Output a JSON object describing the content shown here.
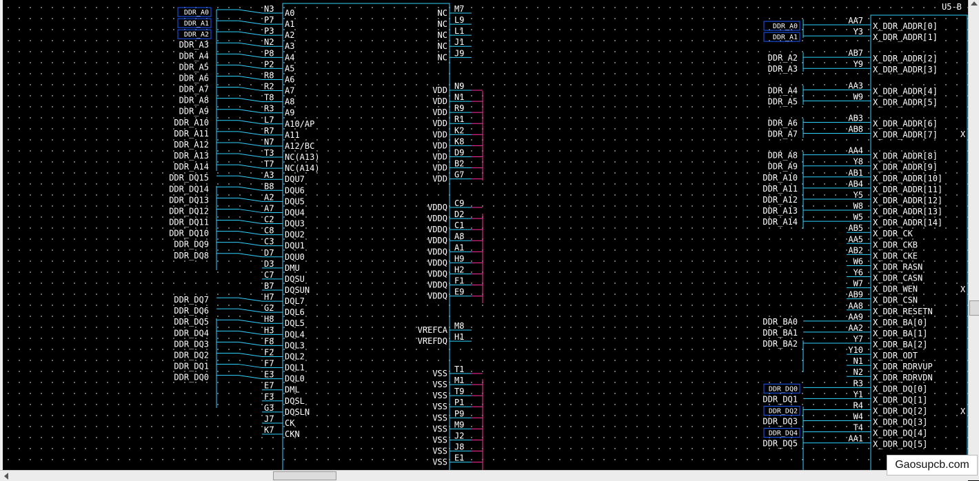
{
  "sheet_ref": "U5-B",
  "watermark": "Gaosupcb.com",
  "colors": {
    "background": "#000000",
    "wire": "#2fd2ff",
    "power_wire": "#ff2fa0",
    "text": "#ffffff",
    "net_box": "#1d5aff"
  },
  "memory_chip": {
    "left_pins": [
      {
        "net": "DDR_A0",
        "pin": "N3",
        "name": "A0"
      },
      {
        "net": "DDR_A1",
        "pin": "P7",
        "name": "A1"
      },
      {
        "net": "DDR_A2",
        "pin": "P3",
        "name": "A2"
      },
      {
        "net": "DDR_A3",
        "pin": "N2",
        "name": "A3"
      },
      {
        "net": "DDR_A4",
        "pin": "P8",
        "name": "A4"
      },
      {
        "net": "DDR_A5",
        "pin": "P2",
        "name": "A5"
      },
      {
        "net": "DDR_A6",
        "pin": "R8",
        "name": "A6"
      },
      {
        "net": "DDR_A7",
        "pin": "R2",
        "name": "A7"
      },
      {
        "net": "DDR_A8",
        "pin": "T8",
        "name": "A8"
      },
      {
        "net": "DDR_A9",
        "pin": "R3",
        "name": "A9"
      },
      {
        "net": "DDR_A10",
        "pin": "L7",
        "name": "A10/AP"
      },
      {
        "net": "DDR_A11",
        "pin": "R7",
        "name": "A11"
      },
      {
        "net": "DDR_A12",
        "pin": "N7",
        "name": "A12/BC"
      },
      {
        "net": "DDR_A13",
        "pin": "T3",
        "name": "NC(A13)"
      },
      {
        "net": "DDR_A14",
        "pin": "T7",
        "name": "NC(A14)"
      },
      {
        "net": "DDR_DQ15",
        "pin": "A3",
        "name": "DQU7"
      },
      {
        "net": "DDR_DQ14",
        "pin": "B8",
        "name": "DQU6"
      },
      {
        "net": "DDR_DQ13",
        "pin": "A2",
        "name": "DQU5"
      },
      {
        "net": "DDR_DQ12",
        "pin": "A7",
        "name": "DQU4"
      },
      {
        "net": "DDR_DQ11",
        "pin": "C2",
        "name": "DQU3"
      },
      {
        "net": "DDR_DQ10",
        "pin": "C8",
        "name": "DQU2"
      },
      {
        "net": "DDR_DQ9",
        "pin": "C3",
        "name": "DQU1"
      },
      {
        "net": "DDR_DQ8",
        "pin": "D7",
        "name": "DQU0"
      },
      {
        "net": "",
        "pin": "D3",
        "name": "DMU"
      },
      {
        "net": "",
        "pin": "C7",
        "name": "DQSU"
      },
      {
        "net": "",
        "pin": "B7",
        "name": "DQSUN"
      },
      {
        "net": "DDR_DQ7",
        "pin": "H7",
        "name": "DQL7"
      },
      {
        "net": "DDR_DQ6",
        "pin": "G2",
        "name": "DQL6"
      },
      {
        "net": "DDR_DQ5",
        "pin": "H8",
        "name": "DQL5"
      },
      {
        "net": "DDR_DQ4",
        "pin": "H3",
        "name": "DQL4"
      },
      {
        "net": "DDR_DQ3",
        "pin": "F8",
        "name": "DQL3"
      },
      {
        "net": "DDR_DQ2",
        "pin": "F2",
        "name": "DQL2"
      },
      {
        "net": "DDR_DQ1",
        "pin": "F7",
        "name": "DQL1"
      },
      {
        "net": "DDR_DQ0",
        "pin": "E3",
        "name": "DQL0"
      },
      {
        "net": "",
        "pin": "E7",
        "name": "DML"
      },
      {
        "net": "",
        "pin": "F3",
        "name": "DQSL"
      },
      {
        "net": "",
        "pin": "G3",
        "name": "DQSLN"
      },
      {
        "net": "",
        "pin": "J7",
        "name": "CK"
      },
      {
        "net": "",
        "pin": "K7",
        "name": "CKN"
      }
    ],
    "right_pins": [
      {
        "name": "NC",
        "pin": "M7"
      },
      {
        "name": "NC",
        "pin": "L9"
      },
      {
        "name": "NC",
        "pin": "L1"
      },
      {
        "name": "NC",
        "pin": "J1"
      },
      {
        "name": "NC",
        "pin": "J9"
      },
      {
        "name": "VDD",
        "pin": "N9"
      },
      {
        "name": "VDD",
        "pin": "N1"
      },
      {
        "name": "VDD",
        "pin": "R9"
      },
      {
        "name": "VDD",
        "pin": "R1"
      },
      {
        "name": "VDD",
        "pin": "K2"
      },
      {
        "name": "VDD",
        "pin": "K8"
      },
      {
        "name": "VDD",
        "pin": "D9"
      },
      {
        "name": "VDD",
        "pin": "B2"
      },
      {
        "name": "VDD",
        "pin": "G7"
      },
      {
        "name": "VDDQ",
        "pin": "C9"
      },
      {
        "name": "VDDQ",
        "pin": "D2"
      },
      {
        "name": "VDDQ",
        "pin": "C1"
      },
      {
        "name": "VDDQ",
        "pin": "A8"
      },
      {
        "name": "VDDQ",
        "pin": "A1"
      },
      {
        "name": "VDDQ",
        "pin": "H9"
      },
      {
        "name": "VDDQ",
        "pin": "H2"
      },
      {
        "name": "VDDQ",
        "pin": "F1"
      },
      {
        "name": "VDDQ",
        "pin": "E9"
      },
      {
        "name": "VREFCA",
        "pin": "M8"
      },
      {
        "name": "VREFDQ",
        "pin": "H1"
      },
      {
        "name": "VSS",
        "pin": "T1"
      },
      {
        "name": "VSS",
        "pin": "M1"
      },
      {
        "name": "VSS",
        "pin": "T9"
      },
      {
        "name": "VSS",
        "pin": "P1"
      },
      {
        "name": "VSS",
        "pin": "P9"
      },
      {
        "name": "VSS",
        "pin": "M9"
      },
      {
        "name": "VSS",
        "pin": "J2"
      },
      {
        "name": "VSS",
        "pin": "J8"
      },
      {
        "name": "VSS",
        "pin": "E1"
      }
    ]
  },
  "controller": {
    "pins": [
      {
        "net": "DDR_A0",
        "pin": "AA7",
        "name": "X_DDR_ADDR[0]"
      },
      {
        "net": "DDR_A1",
        "pin": "Y3",
        "name": "X_DDR_ADDR[1]"
      },
      {
        "net": "DDR_A2",
        "pin": "AB7",
        "name": "X_DDR_ADDR[2]"
      },
      {
        "net": "DDR_A3",
        "pin": "Y9",
        "name": "X_DDR_ADDR[3]"
      },
      {
        "net": "DDR_A4",
        "pin": "AA3",
        "name": "X_DDR_ADDR[4]"
      },
      {
        "net": "DDR_A5",
        "pin": "W9",
        "name": "X_DDR_ADDR[5]"
      },
      {
        "net": "DDR_A6",
        "pin": "AB3",
        "name": "X_DDR_ADDR[6]"
      },
      {
        "net": "DDR_A7",
        "pin": "AB8",
        "name": "X_DDR_ADDR[7]"
      },
      {
        "net": "DDR_A8",
        "pin": "AA4",
        "name": "X_DDR_ADDR[8]"
      },
      {
        "net": "DDR_A9",
        "pin": "Y8",
        "name": "X_DDR_ADDR[9]"
      },
      {
        "net": "DDR_A10",
        "pin": "AB1",
        "name": "X_DDR_ADDR[10]"
      },
      {
        "net": "DDR_A11",
        "pin": "AB4",
        "name": "X_DDR_ADDR[11]"
      },
      {
        "net": "DDR_A12",
        "pin": "Y5",
        "name": "X_DDR_ADDR[12]"
      },
      {
        "net": "DDR_A13",
        "pin": "W8",
        "name": "X_DDR_ADDR[13]"
      },
      {
        "net": "DDR_A14",
        "pin": "W5",
        "name": "X_DDR_ADDR[14]"
      },
      {
        "net": "",
        "pin": "AB5",
        "name": "X_DDR_CK"
      },
      {
        "net": "",
        "pin": "AA5",
        "name": "X_DDR_CKB"
      },
      {
        "net": "",
        "pin": "AB2",
        "name": "X_DDR_CKE"
      },
      {
        "net": "",
        "pin": "W6",
        "name": "X_DDR_RASN"
      },
      {
        "net": "",
        "pin": "Y6",
        "name": "X_DDR_CASN"
      },
      {
        "net": "",
        "pin": "W7",
        "name": "X_DDR_WEN"
      },
      {
        "net": "",
        "pin": "AB9",
        "name": "X_DDR_CSN"
      },
      {
        "net": "",
        "pin": "AA8",
        "name": "X_DDR_RESETN"
      },
      {
        "net": "DDR_BA0",
        "pin": "AA9",
        "name": "X_DDR_BA[0]"
      },
      {
        "net": "DDR_BA1",
        "pin": "AA2",
        "name": "X_DDR_BA[1]"
      },
      {
        "net": "DDR_BA2",
        "pin": "Y7",
        "name": "X_DDR_BA[2]"
      },
      {
        "net": "",
        "pin": "Y10",
        "name": "X_DDR_ODT"
      },
      {
        "net": "",
        "pin": "N1",
        "name": "X_DDR_RDRVUP"
      },
      {
        "net": "",
        "pin": "N2",
        "name": "X_DDR_RDRVDN"
      },
      {
        "net": "DDR_DQ0",
        "pin": "R3",
        "name": "X_DDR_DQ[0]"
      },
      {
        "net": "DDR_DQ1",
        "pin": "Y1",
        "name": "X_DDR_DQ[1]"
      },
      {
        "net": "DDR_DQ2",
        "pin": "R4",
        "name": "X_DDR_DQ[2]"
      },
      {
        "net": "DDR_DQ3",
        "pin": "W4",
        "name": "X_DDR_DQ[3]"
      },
      {
        "net": "DDR_DQ4",
        "pin": "T4",
        "name": "X_DDR_DQ[4]"
      },
      {
        "net": "DDR_DQ5",
        "pin": "AA1",
        "name": "X_DDR_DQ[5]"
      }
    ],
    "x_marks": [
      "X",
      "X",
      "X"
    ]
  }
}
